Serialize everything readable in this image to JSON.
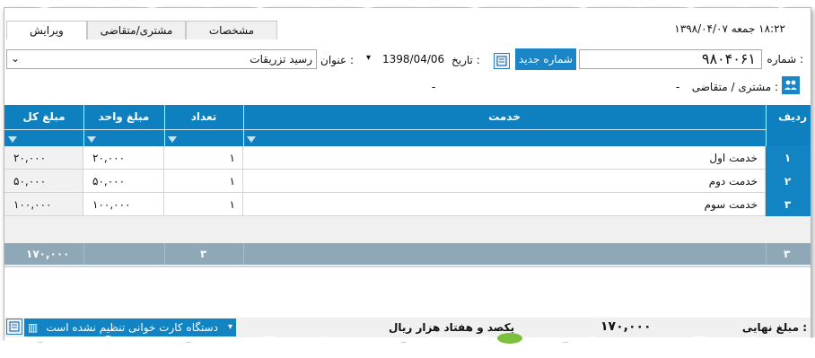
{
  "tabs": [
    {
      "label": "ویرایش"
    },
    {
      "label": "مشتری/متقاضی"
    },
    {
      "label": "مشخصات"
    }
  ],
  "header": {
    "datetime": "۱۸:۲۲  جمعه  ۱۳۹۸/۰۴/۰۷"
  },
  "form": {
    "number_label": "شماره :",
    "number_value": "۹۸۰۴۰۶۱",
    "new_number_button": "شماره جدید",
    "date_label": "تاریخ :",
    "date_value": "1398/04/06",
    "title_label": "عنوان :",
    "title_value": "رسید تزریقات",
    "customer_label": "مشتری / متقاضی :",
    "customer_value": "-",
    "customer_extra": "-"
  },
  "table": {
    "columns": [
      "ردیف",
      "خدمت",
      "تعداد",
      "مبلغ واحد",
      "مبلغ کل"
    ],
    "rows": [
      {
        "idx": "۱",
        "service": "خدمت اول",
        "qty": "۱",
        "unit": "۲۰,۰۰۰",
        "total": "۲۰,۰۰۰"
      },
      {
        "idx": "۲",
        "service": "خدمت دوم",
        "qty": "۱",
        "unit": "۵۰,۰۰۰",
        "total": "۵۰,۰۰۰"
      },
      {
        "idx": "۳",
        "service": "خدمت سوم",
        "qty": "۱",
        "unit": "۱۰۰,۰۰۰",
        "total": "۱۰۰,۰۰۰"
      }
    ],
    "footer": {
      "count": "۳",
      "qty": "۳",
      "total": "۱۷۰,۰۰۰"
    }
  },
  "status": {
    "final_label": "مبلغ نهایی :",
    "final_value": "۱۷۰,۰۰۰",
    "words": "یکصد و هفتاد  هزار  ریال",
    "card_reader": "دستگاه کارت خوانی تنظیم نشده است"
  }
}
